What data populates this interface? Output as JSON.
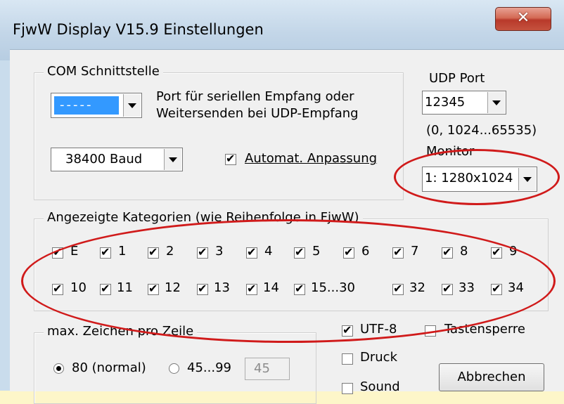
{
  "window": {
    "title": "FjwW Display V15.9 Einstellungen",
    "close": "✕"
  },
  "com": {
    "legend": "COM Schnittstelle",
    "port_value": "-----",
    "desc_line1": "Port für seriellen Empfang oder",
    "desc_line2": "Weitersenden bei UDP-Empfang",
    "baud_value": "38400 Baud",
    "auto_label": "Automat. Anpassung"
  },
  "udp": {
    "label": "UDP Port",
    "value": "12345",
    "range": "(0, 1024...65535)"
  },
  "monitor": {
    "label": "Monitor",
    "value": "1: 1280x1024"
  },
  "categories": {
    "legend": "Angezeigte Kategorien (wie Reihenfolge in FjwW)",
    "row1": [
      "E",
      "1",
      "2",
      "3",
      "4",
      "5",
      "6",
      "7",
      "8",
      "9"
    ],
    "row2": [
      "10",
      "11",
      "12",
      "13",
      "14",
      "15...30",
      "",
      "32",
      "33",
      "34"
    ]
  },
  "maxchars": {
    "legend": "max. Zeichen pro Zeile",
    "opt80": "80 (normal)",
    "opt45": "45...99",
    "num": "45"
  },
  "options": {
    "utf8": "UTF-8",
    "tastensperre": "Tastensperre",
    "druck": "Druck",
    "sound": "Sound",
    "abbrechen": "Abbrechen"
  },
  "colors": {
    "highlight": "#d01a1a",
    "selection": "#3399ff"
  }
}
